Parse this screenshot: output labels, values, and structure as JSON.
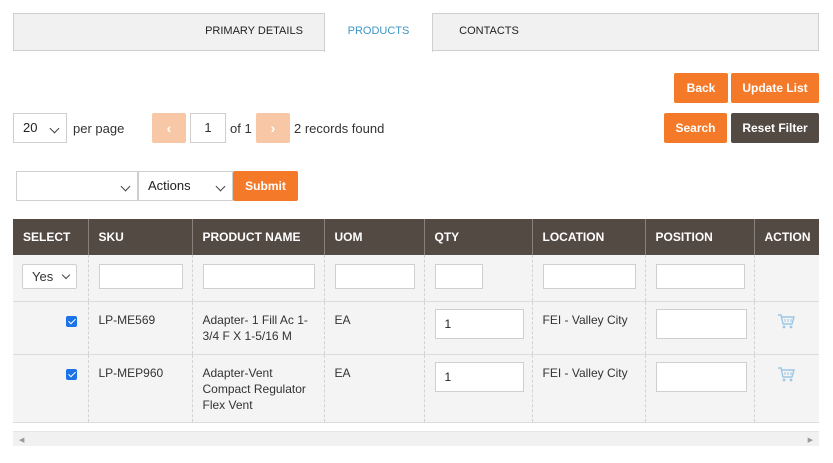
{
  "tabs": [
    {
      "label": "PRIMARY DETAILS",
      "active": false
    },
    {
      "label": "PRODUCTS",
      "active": true
    },
    {
      "label": "CONTACTS",
      "active": false
    }
  ],
  "buttons": {
    "back": "Back",
    "update_list": "Update List",
    "search": "Search",
    "reset_filter": "Reset Filter",
    "submit": "Submit",
    "prev": "‹",
    "next": "›"
  },
  "pagination": {
    "per_page_value": "20",
    "per_page_label": "per page",
    "current_page": "1",
    "of_label": "of 1",
    "records_found": "2 records found"
  },
  "bulk": {
    "first_select_value": "",
    "actions_value": "Actions"
  },
  "table": {
    "headers": [
      "SELECT",
      "SKU",
      "PRODUCT NAME",
      "UOM",
      "QTY",
      "LOCATION",
      "POSITION",
      "ACTION"
    ],
    "filter_select_value": "Yes",
    "rows": [
      {
        "checked": true,
        "sku": "LP-ME569",
        "product_name": "Adapter- 1 Fill Ac 1-3/4 F X 1-5/16 M",
        "uom": "EA",
        "qty": "1",
        "location": "FEI - Valley City",
        "position": ""
      },
      {
        "checked": true,
        "sku": "LP-MEP960",
        "product_name": "Adapter-Vent Compact Regulator Flex Vent",
        "uom": "EA",
        "qty": "1",
        "location": "FEI - Valley City",
        "position": ""
      }
    ]
  },
  "colors": {
    "accent_orange": "#f47a2a",
    "header_dark": "#544a44",
    "tab_active_text": "#3e95c6"
  },
  "icons": {
    "action": "cart-icon"
  }
}
